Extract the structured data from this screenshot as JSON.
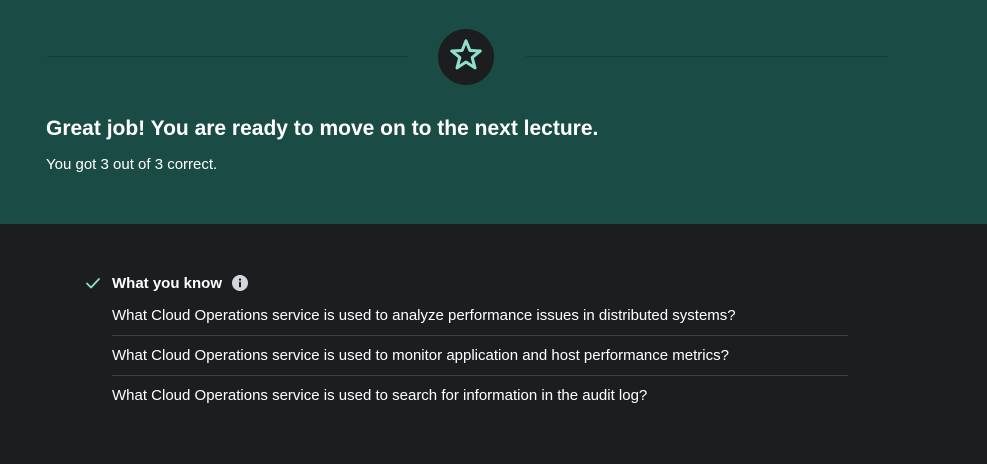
{
  "banner": {
    "icon": "star-icon",
    "headline": "Great job! You are ready to move on to the next lecture.",
    "score_text": "You got 3 out of 3 correct.",
    "colors": {
      "background": "#1a4b44",
      "accent": "#8ee0cd"
    }
  },
  "knowledge": {
    "title": "What you know",
    "status_icon": "check-icon",
    "info_icon": "info-icon",
    "questions": [
      "What Cloud Operations service is used to analyze performance issues in distributed systems?",
      "What Cloud Operations service is used to monitor application and host performance metrics?",
      "What Cloud Operations service is used to search for information in the audit log?"
    ]
  }
}
